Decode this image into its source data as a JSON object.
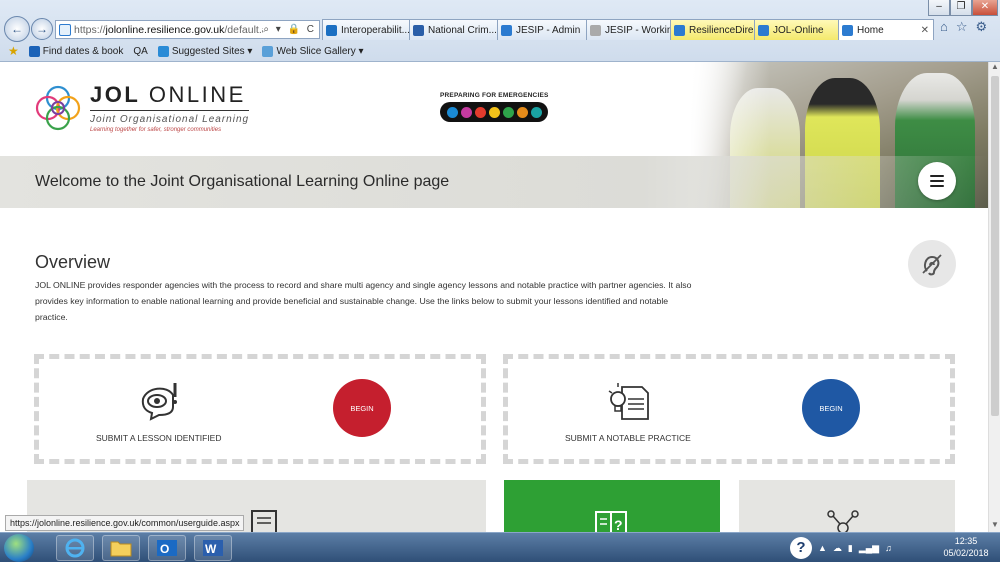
{
  "browser": {
    "address": {
      "prefix": "https://",
      "host": "jolonline.resilience.gov.uk",
      "path": "/default.aspx",
      "tools": "⌕ ▾ 🔒 C"
    },
    "tabs": [
      {
        "label": "Interoperabilit...",
        "color": "#1b6fc2",
        "style": ""
      },
      {
        "label": "National Crim...",
        "color": "#2a5ea8",
        "style": ""
      },
      {
        "label": "JESIP - Admin",
        "color": "#2c7bd0",
        "style": ""
      },
      {
        "label": "JESIP - Workin...",
        "color": "#aaaaaa",
        "style": ""
      },
      {
        "label": "ResilienceDire...",
        "color": "#2c7bd0",
        "style": "yellow"
      },
      {
        "label": "JOL-Online",
        "color": "#2c7bd0",
        "style": "yellow"
      },
      {
        "label": "Home",
        "color": "#2c7bd0",
        "style": "active"
      }
    ],
    "active_tab_close": "✕",
    "favorites": [
      {
        "label": "Find dates & book",
        "color": "#1c63b8"
      },
      {
        "label": "QA",
        "color": ""
      },
      {
        "label": "Suggested Sites ▾",
        "color": "#2a8bd6"
      },
      {
        "label": "Web Slice Gallery ▾",
        "color": "#5aa0d8"
      }
    ],
    "window_controls": {
      "minimize": "–",
      "maximize": "❐",
      "close": "✕"
    },
    "toolbar_icons": [
      "⌂",
      "☆",
      "⚙"
    ]
  },
  "site": {
    "logo": {
      "title_bold": "JOL",
      "title_rest": " ONLINE",
      "subtitle": "Joint Organisational Learning",
      "tagline": "Learning together for safer, stronger communities"
    },
    "pfe": {
      "text": "PREPARING FOR EMERGENCIES",
      "dots": [
        "#1a8ad4",
        "#c43aa0",
        "#e33b2d",
        "#f3c21a",
        "#2ea34a",
        "#e58b1a",
        "#1aa3a3"
      ]
    },
    "welcome_title": "Welcome to the Joint Organisational Learning Online page",
    "overview": {
      "title": "Overview",
      "text": "JOL ONLINE provides responder agencies with the process to record and share multi agency and single agency lessons and notable practice with partner agencies. It also provides key information to enable national learning and provide beneficial and sustainable change. Use the links below to submit your lessons identified and notable practice."
    },
    "cards": [
      {
        "label": "SUBMIT A LESSON IDENTIFIED",
        "button": "BEGIN",
        "button_color": "#c51f2e"
      },
      {
        "label": "SUBMIT A NOTABLE PRACTICE",
        "button": "BEGIN",
        "button_color": "#1f58a4"
      }
    ],
    "tiles": [
      {
        "icon": "user-guide-icon",
        "color": "#e5e5e2"
      },
      {
        "icon": "question-book-icon",
        "color": "#2ea034"
      },
      {
        "icon": "network-icon",
        "color": "#e5e5e2"
      }
    ]
  },
  "status_url": "https://jolonline.resilience.gov.uk/common/userguide.aspx",
  "taskbar": {
    "apps": [
      "internet-explorer-icon",
      "file-explorer-icon",
      "outlook-icon",
      "word-icon"
    ],
    "clock_time": "12:35",
    "clock_date": "05/02/2018"
  }
}
